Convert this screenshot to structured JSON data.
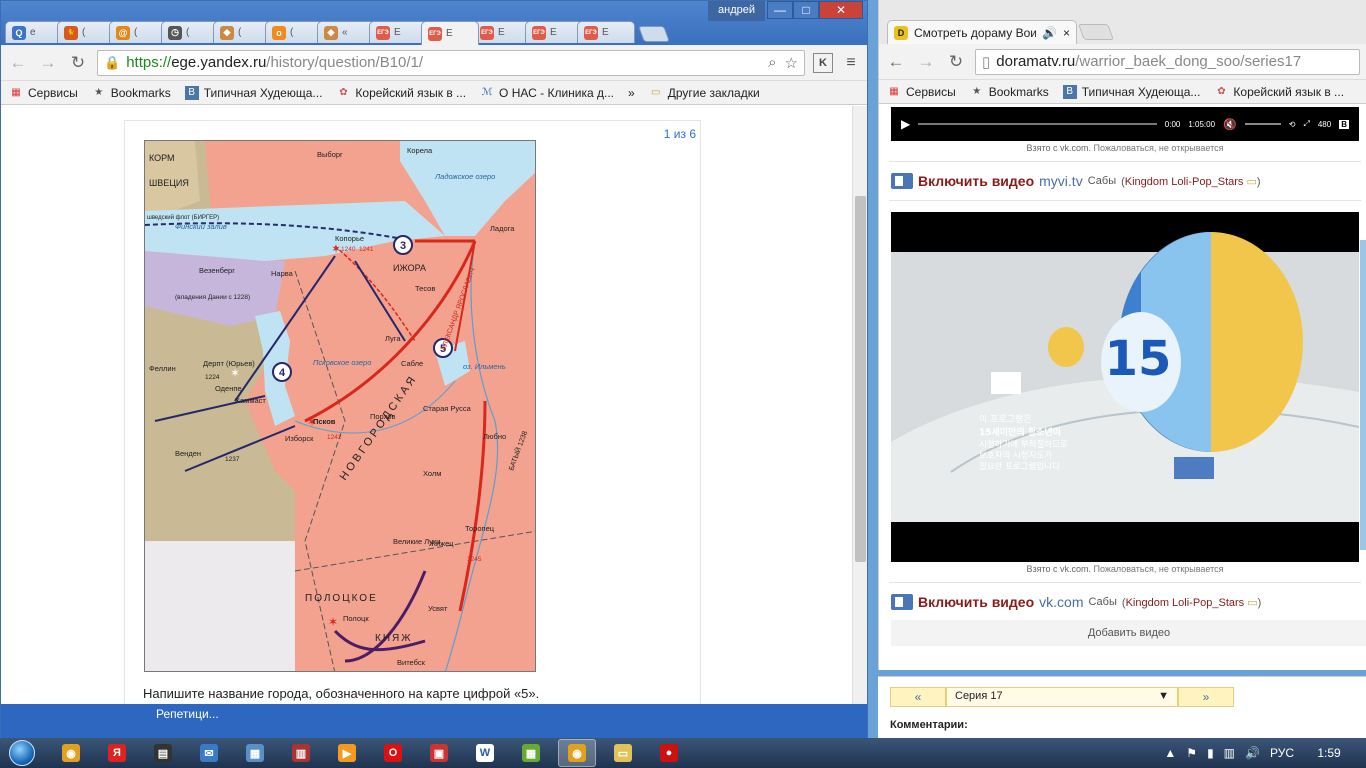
{
  "left_window": {
    "user": "андрей",
    "tabs": [
      {
        "icon": "search-icon",
        "label": "е",
        "color": "#3b73c8",
        "glyph": "Q"
      },
      {
        "icon": "cat-icon",
        "label": "(",
        "color": "#d55a1e",
        "glyph": "🐈"
      },
      {
        "icon": "at-icon",
        "label": "(",
        "color": "#e08a1e",
        "glyph": "@"
      },
      {
        "icon": "clock-icon",
        "label": "(",
        "color": "#555",
        "glyph": "◷"
      },
      {
        "icon": "diamond-icon",
        "label": "(",
        "color": "#c84",
        "glyph": "◆"
      },
      {
        "icon": "ok-icon",
        "label": "(",
        "color": "#f28a1e",
        "glyph": "о"
      },
      {
        "icon": "diamond-icon",
        "label": "«",
        "color": "#c84",
        "glyph": "◆"
      },
      {
        "icon": "ege-icon",
        "label": "Е",
        "color": "#e05c4a",
        "glyph": "ЕГЭ"
      },
      {
        "icon": "ege-icon",
        "label": "Е",
        "color": "#e05c4a",
        "glyph": "ЕГЭ",
        "active": true
      },
      {
        "icon": "ege-icon",
        "label": "Е",
        "color": "#e05c4a",
        "glyph": "ЕГЭ"
      },
      {
        "icon": "ege-icon",
        "label": "Е",
        "color": "#e05c4a",
        "glyph": "ЕГЭ"
      },
      {
        "icon": "ege-icon",
        "label": "Е",
        "color": "#e05c4a",
        "glyph": "ЕГЭ"
      }
    ],
    "url": {
      "scheme": "https://",
      "host": "ege.yandex.ru",
      "path": "/history/question/B10/1/"
    },
    "bookmarks": [
      {
        "icon": "apps-icon",
        "label": "Сервисы"
      },
      {
        "icon": "star-icon",
        "label": "Bookmarks"
      },
      {
        "icon": "vk-icon",
        "label": "Типичная Худеюща..."
      },
      {
        "icon": "flower-icon",
        "label": "Корейский язык в ..."
      },
      {
        "icon": "clinic-icon",
        "label": "О НАС - Клиника д..."
      }
    ],
    "bookmarks_more": "»",
    "other_bookmarks": "Другие закладки",
    "counter": "1 из 6",
    "question": "Напишите название города, обозначенного на карте цифрой «5».",
    "status_text": "Репетици..."
  },
  "map": {
    "labels": {
      "korela": "Корела",
      "ladoga_lake": "Ладожское озеро",
      "ladoga": "Ладога",
      "vyborg": "Выборг",
      "fin_gulf": "Финский залив",
      "shved_flot": "шведский флот (БИРГЕР)",
      "koporye": "Копорье",
      "izhora": "ИЖОРА",
      "vesenberg": "Везенберг",
      "narva": "Нарва",
      "vladenia": "(владения Дании с 1228)",
      "derpt": "Дерпт (Юрьев)",
      "fellin": "Феллин",
      "odenpe": "Оденпе",
      "hammast": "Хаммаст",
      "pskov_lake": "Псковское озеро",
      "izborsk": "Изборск",
      "pskov": "Псков",
      "porhov": "Порхов",
      "staraya_russa": "Старая Русса",
      "luga": "Луга",
      "sablia": "Сабле",
      "tesov": "Тесов",
      "ilmen": "оз. Ильмень",
      "novgorod": "НОВГОРОДСКАЯ",
      "venden": "Венден",
      "holm": "Холм",
      "lubno": "Любно",
      "velikie_luki": "Великие Луки",
      "zhizhets": "Жижец",
      "toropets": "Торопец",
      "usvyat": "Усвят",
      "polotskoe": "ПОЛОЦКОЕ",
      "polotsk": "Полоцк",
      "knyazh": "КНЯЖ",
      "vitebsk": "Витебск",
      "korm": "КОРМ",
      "shvecia": "ШВЕЦИЯ",
      "alexander": "АЛЕКСАНДР ЯРОСЛАВИЧ",
      "batiy": "БАТЫЙ 1238",
      "n3": "3",
      "n4": "4",
      "n5": "5",
      "y1240a": "1240",
      "y1241": "1241",
      "y1242": "1242",
      "y1245": "1245",
      "y1224": "1224",
      "y1237": "1237"
    }
  },
  "right_window": {
    "tab_title": "Смотреть дораму Вои",
    "url": {
      "host": "doramatv.ru",
      "path": "/warrior_baek_dong_soo/series17"
    },
    "bookmarks": [
      {
        "icon": "apps-icon",
        "label": "Сервисы"
      },
      {
        "icon": "star-icon",
        "label": "Bookmarks"
      },
      {
        "icon": "vk-icon",
        "label": "Типичная Худеюща..."
      },
      {
        "icon": "flower-icon",
        "label": "Корейский язык в ..."
      }
    ],
    "player": {
      "time_now": "0:00",
      "time_total": "1:05:00",
      "quality": "480"
    },
    "vk_note": {
      "taken": "Взято с vk.com.",
      "complain": "Пожаловаться, не открывается"
    },
    "video1": {
      "label": "Включить видео",
      "source": "myvi.tv",
      "subs": "Сабы",
      "group": "Kingdom Loli-Pop_Stars"
    },
    "video2": {
      "label": "Включить видео",
      "source": "vk.com",
      "subs": "Сабы",
      "group": "Kingdom Loli-Pop_Stars"
    },
    "overlay": {
      "line1": "이 프로그램은",
      "line2": "15세미만의 청소년이",
      "line3": "시청하기에 부적절하므로",
      "line4": "보호자의 시청지도가",
      "line5": "필요한 프로그램입니다",
      "badge": "15"
    },
    "add_video": "Добавить видео",
    "series": {
      "prev": "«",
      "value": "Серия 17",
      "next": "»"
    },
    "comments": "Комментарии:"
  },
  "taskbar": {
    "lang": "РУС",
    "time": "1:59",
    "apps": [
      {
        "icon": "chrome-icon"
      },
      {
        "icon": "yandex-icon"
      },
      {
        "icon": "clapper-icon"
      },
      {
        "icon": "mail-icon"
      },
      {
        "icon": "calculator-icon"
      },
      {
        "icon": "archive-icon"
      },
      {
        "icon": "player-icon"
      },
      {
        "icon": "opera-icon"
      },
      {
        "icon": "screenshot-icon"
      },
      {
        "icon": "word-icon"
      },
      {
        "icon": "mosaic-icon"
      },
      {
        "icon": "chrome-icon",
        "active": true
      },
      {
        "icon": "folder-icon"
      },
      {
        "icon": "record-icon"
      }
    ]
  }
}
